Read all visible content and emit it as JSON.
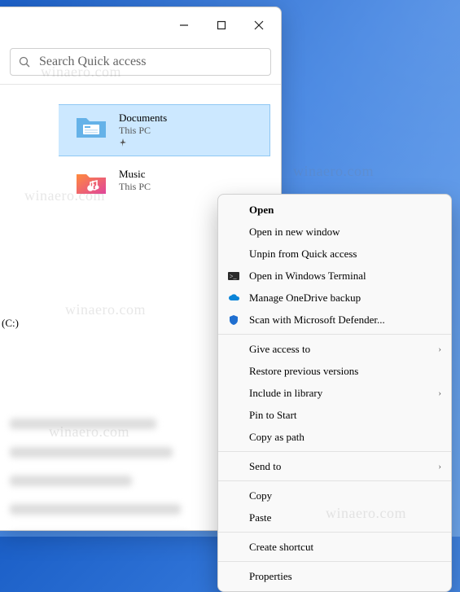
{
  "search": {
    "placeholder": "Search Quick access"
  },
  "sidebar": {
    "drive_label": "(C:)"
  },
  "items": [
    {
      "title": "Documents",
      "sub": "This PC"
    },
    {
      "title": "Music",
      "sub": "This PC"
    }
  ],
  "menu": {
    "open": "Open",
    "open_new": "Open in new window",
    "unpin": "Unpin from Quick access",
    "terminal": "Open in Windows Terminal",
    "onedrive": "Manage OneDrive backup",
    "defender": "Scan with Microsoft Defender...",
    "give_access": "Give access to",
    "restore": "Restore previous versions",
    "include_lib": "Include in library",
    "pin_start": "Pin to Start",
    "copy_path": "Copy as path",
    "send_to": "Send to",
    "copy": "Copy",
    "paste": "Paste",
    "shortcut": "Create shortcut",
    "properties": "Properties"
  },
  "watermark": "winaero.com"
}
